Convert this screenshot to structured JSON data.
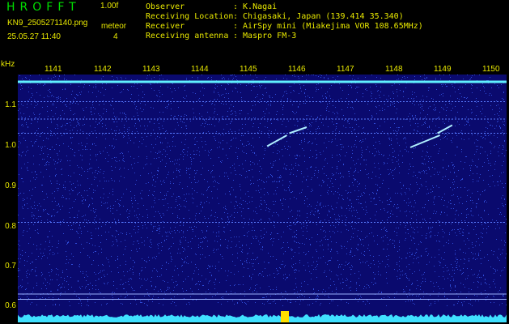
{
  "header": {
    "app_title": "HROFFT",
    "version": "1.00f",
    "file_name": "KN9_2505271140.png",
    "mode": "meteor",
    "timestamp": "25.05.27 11:40",
    "count": "4"
  },
  "info": [
    {
      "key": "Observer",
      "value": ": K.Nagai"
    },
    {
      "key": "Receiving Location",
      "value": ": Chigasaki, Japan (139.414 35.340)"
    },
    {
      "key": "Receiver",
      "value": ": AirSpy mini (Miakejima VOR 108.65MHz)"
    },
    {
      "key": "Receiving antenna",
      "value": ": Maspro FM-3"
    }
  ],
  "axes": {
    "y_unit": "kHz",
    "y_ticks": [
      "1.1",
      "1.0",
      "0.9",
      "0.8",
      "0.7",
      "0.6"
    ],
    "x_ticks": [
      "1141",
      "1142",
      "1143",
      "1144",
      "1145",
      "1146",
      "1147",
      "1148",
      "1149",
      "1150"
    ]
  },
  "colors": {
    "background": "#000000",
    "label": "#e8e800",
    "title": "#00e000",
    "waterfall_bg": "#0a0a6e",
    "noise": "#2f4bd6",
    "carrier": "#60f0ff",
    "spectrum": "#40e0ff",
    "marker": "#ffe000"
  },
  "spectrogram": {
    "f_min_khz": 0.6,
    "f_max_khz": 1.15,
    "time_start": 1140.5,
    "time_end": 1150.4,
    "carrier_khz": 1.148,
    "steady_lines_khz": [
      1.098,
      1.055,
      1.02,
      0.8,
      0.623,
      0.61
    ],
    "meteor_echoes": [
      {
        "t_start": 1145.55,
        "f_start": 0.988,
        "t_end": 1145.95,
        "f_end": 1.015
      },
      {
        "t_start": 1146.0,
        "f_start": 1.02,
        "t_end": 1146.35,
        "f_end": 1.035
      },
      {
        "t_start": 1148.45,
        "f_start": 0.985,
        "t_end": 1149.05,
        "f_end": 1.015
      },
      {
        "t_start": 1149.0,
        "f_start": 1.02,
        "t_end": 1149.3,
        "f_end": 1.04
      }
    ]
  }
}
